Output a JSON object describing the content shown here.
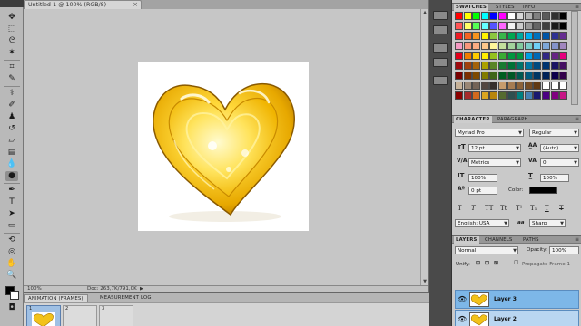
{
  "document": {
    "tab_title": "Untitled-1 @ 100% (RGB/8)",
    "zoom": "100%",
    "doc_info": "Doc: 263,7K/791,0K",
    "doc_info_arrow": "▶"
  },
  "animation_panel": {
    "tabs": [
      "ANIMATION (FRAMES)",
      "MEASUREMENT LOG"
    ],
    "frames": [
      {
        "number": "1",
        "selected": true
      },
      {
        "number": "2",
        "selected": false
      },
      {
        "number": "3",
        "selected": false
      }
    ]
  },
  "swatches_panel": {
    "tabs": [
      "SWATCHES",
      "STYLES",
      "INFO"
    ],
    "colors": [
      [
        "#ff0000",
        "#ffff00",
        "#00ff00",
        "#00ffff",
        "#0000ff",
        "#ff00ff",
        "#ffffff",
        "#d9d9d9",
        "#b3b3b3",
        "#808080",
        "#5a5a5a",
        "#303030",
        "#000000"
      ],
      [
        "#ff5555",
        "#ffff66",
        "#55ff55",
        "#66ffff",
        "#5555ff",
        "#ff66ff",
        "#f2f2f2",
        "#cccccc",
        "#999999",
        "#666666",
        "#404040",
        "#1a1a1a",
        "#000000"
      ],
      [
        "#ed1c24",
        "#f26522",
        "#f7941d",
        "#fff200",
        "#8dc63f",
        "#39b54a",
        "#00a651",
        "#00a99d",
        "#00aeef",
        "#0072bc",
        "#0054a6",
        "#2e3192",
        "#662d91"
      ],
      [
        "#f49ac2",
        "#f7977a",
        "#fbad82",
        "#fdc68a",
        "#fff79a",
        "#c4df9b",
        "#a3d39c",
        "#82ca9d",
        "#7bcdc8",
        "#6ecff6",
        "#7ea7d8",
        "#8493ca",
        "#a187be"
      ],
      [
        "#e2001a",
        "#ef7d00",
        "#ffcc00",
        "#ffed00",
        "#95c11f",
        "#3aaa35",
        "#009640",
        "#00963f",
        "#009fe3",
        "#0069b4",
        "#312783",
        "#662483",
        "#e6007e"
      ],
      [
        "#9e0b0f",
        "#a0410d",
        "#a3620a",
        "#aba000",
        "#598527",
        "#1a7b30",
        "#007236",
        "#00746b",
        "#0076a3",
        "#004b80",
        "#003471",
        "#1b1464",
        "#440e62"
      ],
      [
        "#790000",
        "#7b2e00",
        "#7d4900",
        "#827b00",
        "#406618",
        "#005e20",
        "#005826",
        "#005952",
        "#005b7f",
        "#003663",
        "#002157",
        "#0d004c",
        "#32004b"
      ],
      [
        "#c7b299",
        "#998675",
        "#736357",
        "#534741",
        "#37302d",
        "#c69c6d",
        "#a67c52",
        "#8c6239",
        "#754c24",
        "#603913",
        "#ffffff",
        "#ffffff",
        "#ffffff"
      ],
      [
        "#8b0000",
        "#a52a2a",
        "#d2691e",
        "#daa520",
        "#b8860b",
        "#556b2f",
        "#2f4f4f",
        "#008080",
        "#4682b4",
        "#191970",
        "#4b0082",
        "#800080",
        "#c71585"
      ]
    ]
  },
  "character_panel": {
    "tabs": [
      "CHARACTER",
      "PARAGRAPH"
    ],
    "font_family": "Myriad Pro",
    "font_style": "Regular",
    "font_size": "12 pt",
    "leading": "(Auto)",
    "kerning": "Metrics",
    "tracking": "0",
    "vertical_scale": "100%",
    "horizontal_scale": "100%",
    "baseline_shift": "0 pt",
    "color_label": "Color:",
    "text_styles": [
      "T",
      "T",
      "TT",
      "Tt",
      "T¹",
      "T₁",
      "T",
      "T"
    ],
    "language": "English: USA",
    "antialias_icon": "aa",
    "antialias": "Sharp"
  },
  "layers_panel": {
    "tabs": [
      "LAYERS",
      "CHANNELS",
      "PATHS"
    ],
    "blend_mode": "Normal",
    "opacity_label": "Opacity:",
    "opacity": "100%",
    "unify_label": "Unify:",
    "propagate_label": "Propagate Frame 1",
    "layers": [
      {
        "name": "Layer 3"
      },
      {
        "name": "Layer 2"
      }
    ]
  },
  "toolbar": {
    "foreground_color": "#000000",
    "background_color": "#ffffff"
  }
}
